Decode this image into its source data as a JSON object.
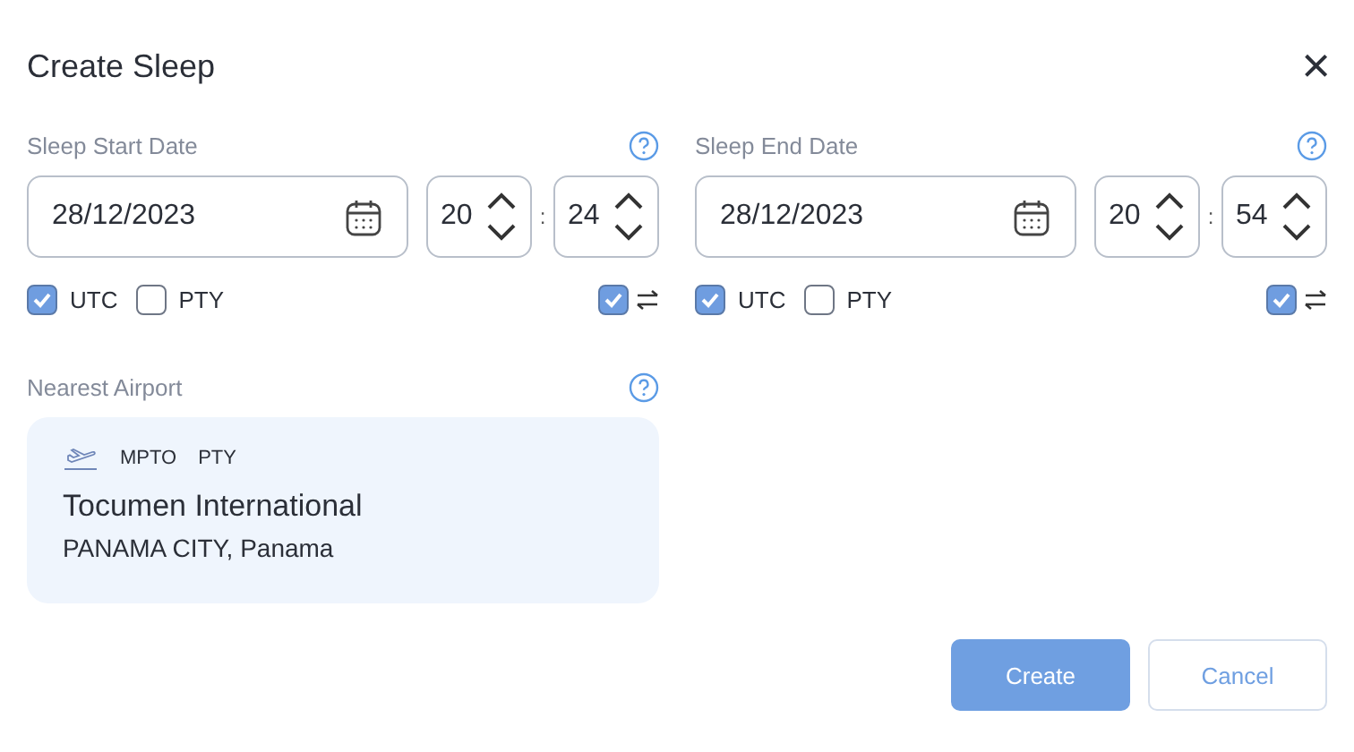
{
  "title": "Create Sleep",
  "close": "×",
  "sections": [
    {
      "label": "Sleep Start Date",
      "date": "28/12/2023",
      "hour": "20",
      "separator": ":",
      "minute": "24",
      "zones": [
        {
          "label": "UTC",
          "checked": true
        },
        {
          "label": "PTY",
          "checked": false
        }
      ],
      "swap_checked": true
    },
    {
      "label": "Sleep End Date",
      "date": "28/12/2023",
      "hour": "20",
      "separator": ":",
      "minute": "54",
      "zones": [
        {
          "label": "UTC",
          "checked": true
        },
        {
          "label": "PTY",
          "checked": false
        }
      ],
      "swap_checked": true
    }
  ],
  "airport": {
    "label": "Nearest Airport",
    "codes": [
      "MPTO",
      "PTY"
    ],
    "name": "Tocumen International",
    "city": "PANAMA CITY, Panama"
  },
  "buttons": [
    {
      "label": "Create",
      "kind": "primary"
    },
    {
      "label": "Cancel",
      "kind": "secondary"
    }
  ]
}
